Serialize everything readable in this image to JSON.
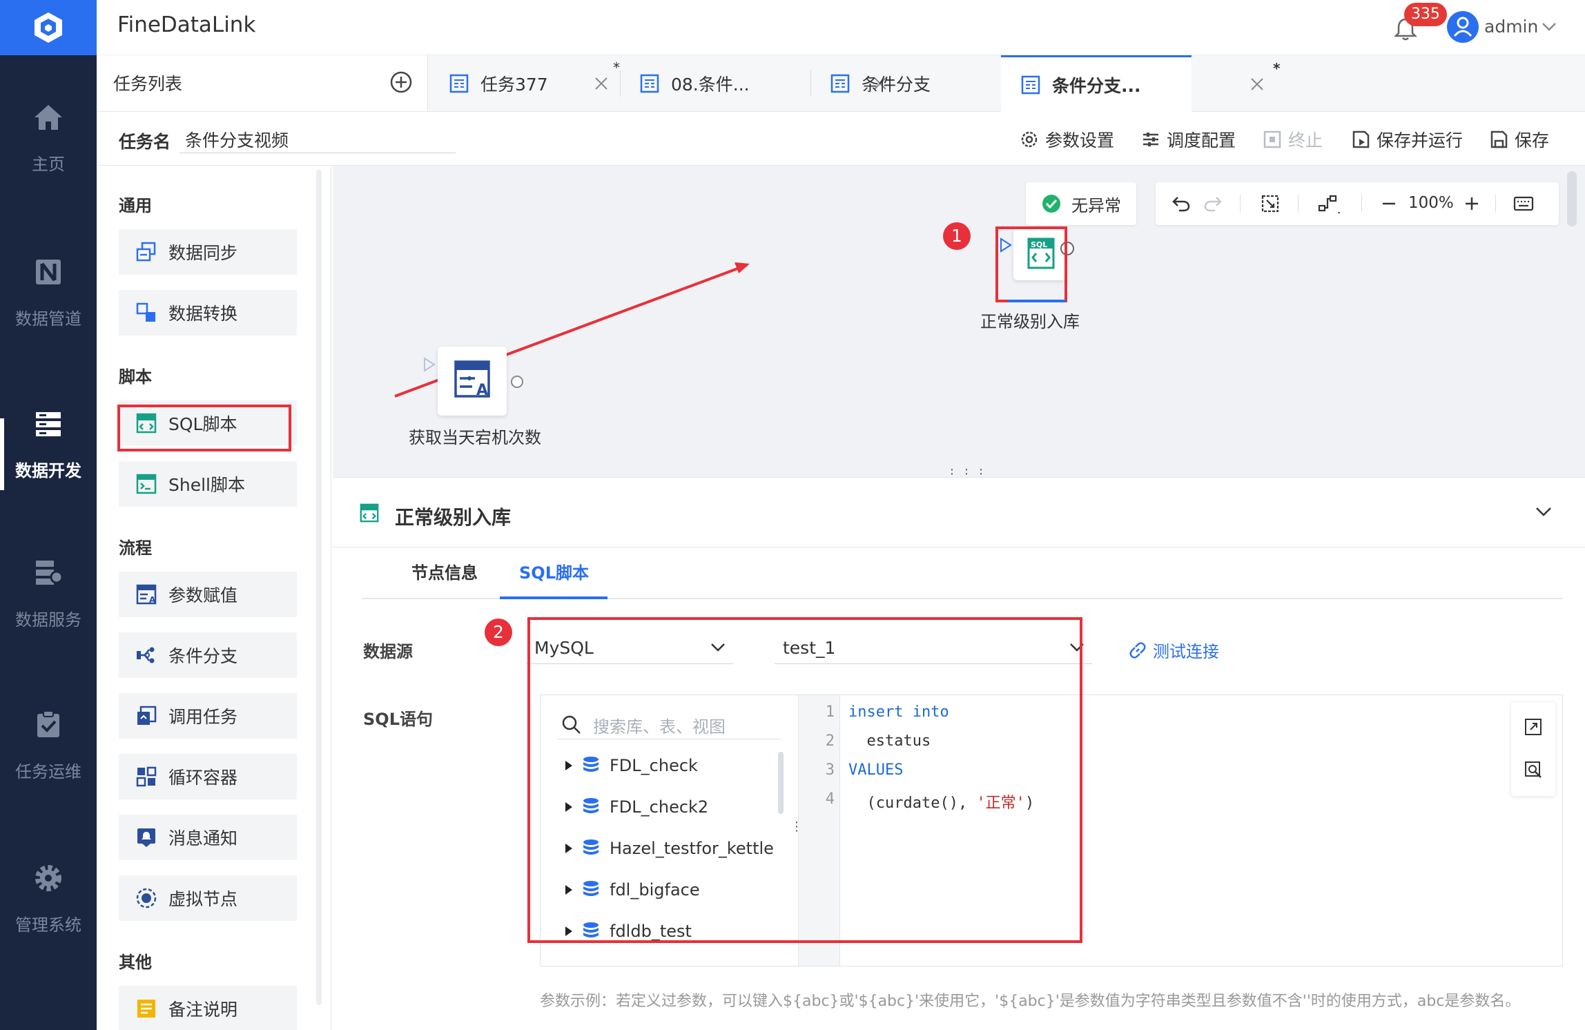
{
  "app": {
    "title": "FineDataLink",
    "notifications": "335",
    "user": "admin"
  },
  "nav": [
    {
      "label": "主页"
    },
    {
      "label": "数据管道"
    },
    {
      "label": "数据开发"
    },
    {
      "label": "数据服务"
    },
    {
      "label": "任务运维"
    },
    {
      "label": "管理系统"
    }
  ],
  "tabs": {
    "task_list": "任务列表",
    "items": [
      {
        "label": "任务377",
        "modified": "*"
      },
      {
        "label": "08.条件...",
        "modified": ""
      },
      {
        "label": "条件分支",
        "modified": ""
      },
      {
        "label": "条件分支...",
        "modified": "*"
      }
    ]
  },
  "task": {
    "name_label": "任务名",
    "name_value": "条件分支视频",
    "tools": [
      "参数设置",
      "调度配置",
      "终止",
      "保存并运行",
      "保存"
    ]
  },
  "palette": {
    "sections": [
      "通用",
      "脚本",
      "流程",
      "其他"
    ],
    "general": [
      "数据同步",
      "数据转换"
    ],
    "script": [
      "SQL脚本",
      "Shell脚本"
    ],
    "flow": [
      "参数赋值",
      "条件分支",
      "调用任务",
      "循环容器",
      "消息通知",
      "虚拟节点"
    ],
    "other": [
      "备注说明"
    ]
  },
  "canvas": {
    "status": "无异常",
    "zoom": "100%",
    "nodes": [
      {
        "label": "正常级别入库"
      },
      {
        "label": "获取当天宕机次数"
      }
    ],
    "markers": [
      "1",
      "2"
    ]
  },
  "detail": {
    "title": "正常级别入库",
    "tabs": [
      "节点信息",
      "SQL脚本"
    ],
    "datasource_label": "数据源",
    "datasource_type": "MySQL",
    "datasource_conn": "test_1",
    "test_connection": "测试连接",
    "sql_label": "SQL语句",
    "search_placeholder": "搜索库、表、视图",
    "tree": [
      "FDL_check",
      "FDL_check2",
      "Hazel_testfor_kettle",
      "fdl_bigface",
      "fdldb_test"
    ],
    "line_numbers": [
      "1",
      "2",
      "3",
      "4"
    ],
    "code": {
      "l1": "insert into",
      "l2": "  estatus",
      "l3": "VALUES",
      "l4a": "  (curdate(), ",
      "l4b": "'正常'",
      "l4c": ")"
    },
    "hint": "参数示例：若定义过参数，可以键入${abc}或'${abc}'来使用它，'${abc}'是参数值为字符串类型且参数值不含''时的使用方式，abc是参数名。"
  },
  "colors": {
    "accent": "#2a6ff0",
    "nav_bg": "#1a2640",
    "highlight": "#e8303a",
    "success": "#21b36b"
  }
}
